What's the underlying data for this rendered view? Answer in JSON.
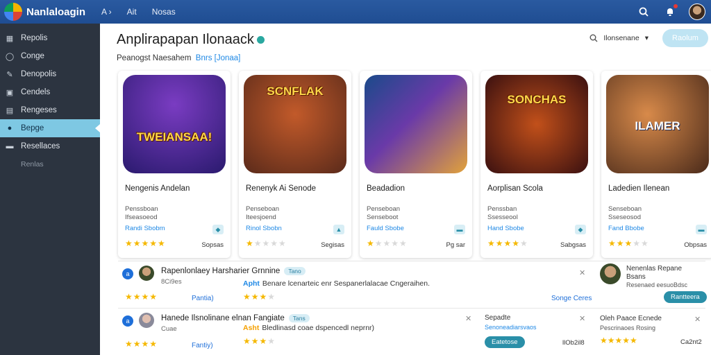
{
  "header": {
    "logo": "Nanlaloagin",
    "nav": [
      "A ›",
      "Ait",
      "Nosas"
    ],
    "icons": [
      "search-icon",
      "notifications-icon"
    ]
  },
  "sidebar": {
    "items": [
      {
        "label": "Repolis",
        "icon": "grid-icon"
      },
      {
        "label": "Conge",
        "icon": "circle-icon"
      },
      {
        "label": "Denopolis",
        "icon": "tool-icon"
      },
      {
        "label": "Cendels",
        "icon": "box-icon"
      },
      {
        "label": "Rengeses",
        "icon": "list-icon"
      },
      {
        "label": "Bepge",
        "icon": "dot-icon"
      },
      {
        "label": "Resellaces",
        "icon": "folder-icon"
      }
    ],
    "footer": "Renlas"
  },
  "main": {
    "title": "Anplirapapan Ilonaack",
    "subtitle": "Peanogst Naesahem",
    "subtitle_link": "Bnrs [Jonaa]",
    "sort_label": "Ilonsenane",
    "primary_button": "Raolum",
    "cards": [
      {
        "name": "Nengenis Andelan",
        "art_title": "TWEIANSAA!",
        "meta1": "Penssboan",
        "meta2": "Ifseasoeod",
        "meta3": "Randi Sbobm",
        "rating": 5,
        "price": "Sopsas",
        "colors": [
          "#2a1a6e",
          "#7a3cc2"
        ]
      },
      {
        "name": "Renenyk Ai Senode",
        "art_title": "SCNFLAK",
        "meta1": "Penseboan",
        "meta2": "Iteesjoend",
        "meta3": "Rinol Sbobn",
        "rating": 1,
        "price": "Segisas",
        "colors": [
          "#5a2a1a",
          "#c25a2a"
        ]
      },
      {
        "name": "Beadadion",
        "art_title": "",
        "meta1": "Penseboan",
        "meta2": "Senseboot",
        "meta3": "Fauld Sbobe",
        "rating": 1,
        "price": "Pg sar",
        "colors": [
          "#1a4a8a",
          "#e2a23a"
        ]
      },
      {
        "name": "Aorplisan Scola",
        "art_title": "SONCHAS",
        "meta1": "Penssban",
        "meta2": "Ssesseool",
        "meta3": "Hand Sbobe",
        "rating": 4,
        "price": "Sabgsas",
        "colors": [
          "#3a1010",
          "#c2501a"
        ]
      },
      {
        "name": "Ladedien Ilenean",
        "art_title": "ILAMER",
        "meta1": "Senseboan",
        "meta2": "Sseseosod",
        "meta3": "Fand Bbobe",
        "rating": 3,
        "price": "Obpsas",
        "colors": [
          "#4a2a1a",
          "#d88a4a"
        ]
      }
    ],
    "reviews": [
      {
        "num": "a",
        "title": "Rapenlonlaey Harsharier Grnnine",
        "tag": "Tano",
        "meta": "8Ci9es",
        "lead": "Apht",
        "body": "Benare lcenarteic enr Sespanerlalacae Cngeraihen.",
        "rating": 4,
        "link": "Pantia)",
        "rating2": 3,
        "link2": "Songe Ceres",
        "panel_title": "Nenenlas Repane",
        "panel_sub": "Bsans",
        "panel_meta": "Resenaed eesuoBdsc",
        "panel_btn": "Rantteera"
      },
      {
        "num": "a",
        "title": "Hanede Ilsnolinane elnan Fangiate",
        "tag": "Tans",
        "meta": "Cuae",
        "lead": "Asht",
        "body": "Bledlinasd coae dspencedl neprnr)",
        "rating": 4,
        "link": "Fantiy)",
        "rating2": 3,
        "panel2_title": "Sepadte",
        "panel2_meta": "Senoneadiarsvaos",
        "panel2_btn": "Eatetose",
        "panel2_price": "llOb2il8",
        "panel_title": "Oleh Paace Ecnede",
        "panel_meta": "Pescrinaoes Rosing",
        "panel_price": "Ca2nt2"
      }
    ]
  }
}
